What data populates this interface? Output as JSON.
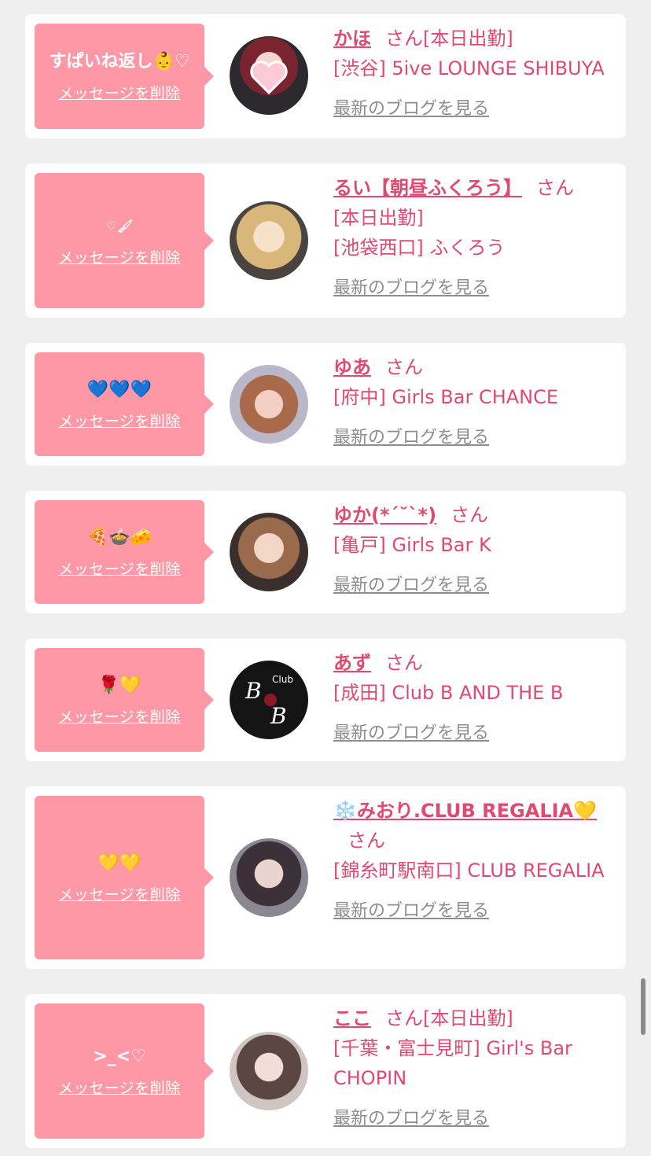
{
  "delete_label": "メッセージを削除",
  "blog_label": "最新のブログを見る",
  "honorific": "さん",
  "today_label": "[本日出勤]",
  "cards": [
    {
      "message": "すぱいね返し👶♡",
      "name": "かほ",
      "shop": "[渋谷] 5ive LOUNGE SHIBUYA",
      "today": "[本日出勤]"
    },
    {
      "message": "♡︎🖌",
      "name": "るい【朝昼ふくろう】",
      "shop": "[池袋西口] ふくろう",
      "today": "[本日出勤]"
    },
    {
      "message": "💙💙💙",
      "name": "ゆあ",
      "shop": "[府中] Girls Bar CHANCE"
    },
    {
      "message": "🍕🍲🧀",
      "name": "ゆか(*´˘`*)",
      "shop": "[亀戸] Girls Bar K"
    },
    {
      "message": "🌹💛",
      "name": "あず",
      "shop": "[成田] Club B AND THE B",
      "logo_text": "Club B AND THE B"
    },
    {
      "message": "💛💛",
      "name": "❄️みおり.CLUB REGALIA💛",
      "shop": "[錦糸町駅南口] CLUB REGALIA"
    },
    {
      "message": ">_<♡",
      "name": "ここ",
      "shop": "[千葉・富士見町] Girl's Bar CHOPIN",
      "today": "[本日出勤]"
    }
  ]
}
